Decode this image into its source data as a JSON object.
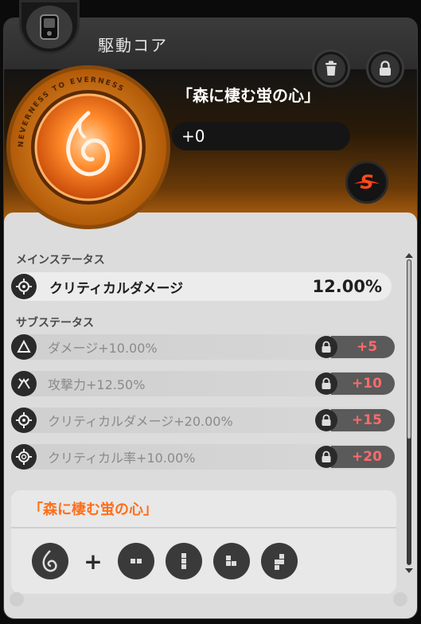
{
  "header": {
    "title": "駆動コア",
    "device_icon": "handheld-device-icon"
  },
  "buttons": {
    "delete_icon": "trash-icon",
    "lock_icon": "lock-icon"
  },
  "core": {
    "name": "「森に棲む蛍の心」",
    "level": "+0",
    "disc_ring_text": "NEVERNESS TO EVERNESS",
    "rank_badge": "S"
  },
  "main_stats": {
    "section_label": "メインステータス",
    "items": [
      {
        "label": "クリティカルダメージ",
        "value": "12.00%",
        "icon": "crosshair-icon"
      }
    ]
  },
  "sub_stats": {
    "section_label": "サブステータス",
    "items": [
      {
        "label": "ダメージ+10.00%",
        "upgrade": "+5",
        "icon": "triangle-icon"
      },
      {
        "label": "攻撃力+12.50%",
        "upgrade": "+10",
        "icon": "attack-icon"
      },
      {
        "label": "クリティカルダメージ+20.00%",
        "upgrade": "+15",
        "icon": "crosshair-icon"
      },
      {
        "label": "クリティカル率+10.00%",
        "upgrade": "+20",
        "icon": "crit-rate-icon"
      }
    ]
  },
  "set_bonus": {
    "title": "「森に棲む蛍の心」",
    "plus": "+",
    "icons": [
      "flame-core-icon",
      "block-icon",
      "block-icon",
      "block-icon",
      "block-icon"
    ]
  },
  "colors": {
    "accent_orange": "#ff6e1a",
    "upgrade_red": "#ff6a6a",
    "hero_gradient_end": "#c06a10"
  }
}
